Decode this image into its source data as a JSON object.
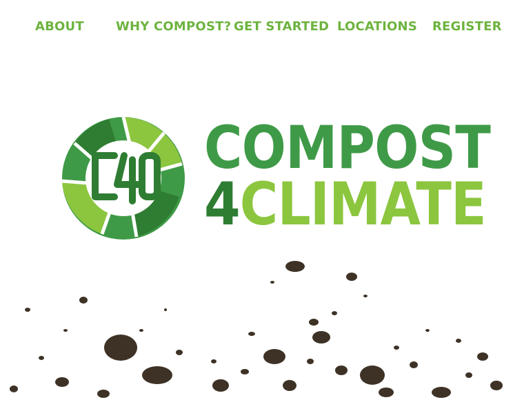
{
  "nav": {
    "about": "ABOUT",
    "why": "WHY COMPOST?",
    "get_started": "GET STARTED",
    "locations": "LOCATIONS",
    "register": "REGISTER"
  },
  "logo": {
    "line1": "COMPOST",
    "line2_number": "4",
    "line2_word": "CLIMATE",
    "emblem_text": "C40"
  },
  "colors": {
    "nav_green": "#6db33f",
    "dark_green": "#2e7d32",
    "mid_green": "#3f9a47",
    "light_green": "#8cc63f",
    "soil": "#3e3226"
  }
}
